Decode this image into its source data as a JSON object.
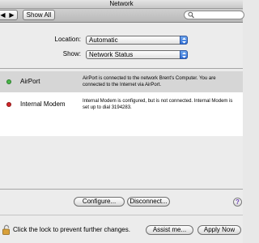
{
  "window": {
    "title": "Network"
  },
  "toolbar": {
    "back_glyph": "◀",
    "forward_glyph": "▶",
    "show_all_label": "Show All",
    "search_value": ""
  },
  "location": {
    "label": "Location:",
    "value": "Automatic"
  },
  "show": {
    "label": "Show:",
    "value": "Network Status"
  },
  "services": [
    {
      "name": "AirPort",
      "status_color": "#4bb84b",
      "description": "AirPort is connected to the network Brent's Computer. You are connected to the Internet via AirPort.",
      "selected": true
    },
    {
      "name": "Internal Modem",
      "status_color": "#d2262a",
      "description": "Internal Modem is configured, but is not connected. Internal Modem is set up to dial 3194283.",
      "selected": false
    }
  ],
  "buttons": {
    "configure": "Configure...",
    "disconnect": "Disconnect...",
    "help": "?",
    "assist": "Assist me...",
    "apply": "Apply Now"
  },
  "lock": {
    "text": "Click the lock to prevent further changes."
  }
}
